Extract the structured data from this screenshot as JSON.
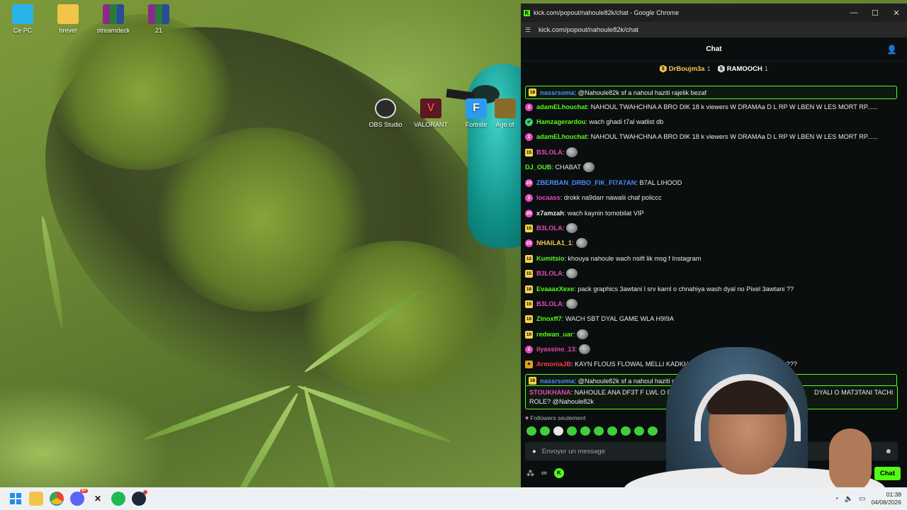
{
  "desktop": {
    "icons": [
      {
        "label": "Ce PC",
        "icon": "monitor-icon",
        "color": "#2ab3e8"
      },
      {
        "label": "brevet",
        "icon": "folder-icon",
        "color": "#f3c44a"
      },
      {
        "label": "streamdeck",
        "icon": "winrar-icon",
        "color": "#8a2a8a"
      },
      {
        "label": "21",
        "icon": "winrar-icon",
        "color": "#8a2a8a"
      },
      {
        "label": "OBS Studio",
        "icon": "obs-icon",
        "color": "#2b2b2b"
      },
      {
        "label": "VALORANT",
        "icon": "valorant-icon",
        "color": "#fa4454"
      },
      {
        "label": "Fortnite",
        "icon": "fortnite-icon",
        "color": "#2d9bf0"
      },
      {
        "label": "Age of",
        "icon": "age-of-empires-icon",
        "color": "#8a6a2a"
      }
    ]
  },
  "window": {
    "title": "kick.com/popout/nahoule82k/chat - Google Chrome",
    "url": "kick.com/popout/nahoule82k/chat",
    "controls": {
      "minimize": "—",
      "maximize": "☐",
      "close": "✕"
    }
  },
  "chat": {
    "header_title": "Chat",
    "leaderboard": [
      {
        "name": "DrBoujm3a",
        "count": "1",
        "color": "#f6c94a"
      },
      {
        "name": "RAMOOCH",
        "count": "1",
        "color": "#ffffff"
      }
    ],
    "messages": [
      {
        "badge": "18",
        "badge_type": "sub",
        "user": "nassrsoma",
        "color": "#4b8bff",
        "text": ": @Nahoule82k sf a nahoul haziti rajelik bezaf",
        "highlight": true
      },
      {
        "badge": "2",
        "badge_type": "round",
        "user": "adamELhouchat",
        "color": "#53fc18",
        "text": ": NAHOUL TWAHCHNA A BRO DIK 18 k viewers W DRAMAa D L RP W LBEN W LES MORT RP......",
        "highlight": false
      },
      {
        "badge": "✔",
        "badge_type": "green",
        "user": "Hamzagerardou",
        "color": "#53fc18",
        "text": ": wach ghadi t7al watlist db",
        "highlight": false
      },
      {
        "badge": "2",
        "badge_type": "round",
        "user": "adamELhouchat",
        "color": "#53fc18",
        "text": ": NAHOUL TWAHCHNA A BRO DIK 18 k viewers W DRAMAa D L RP W LBEN W LES MORT RP......",
        "highlight": false
      },
      {
        "badge": "15",
        "badge_type": "sub",
        "user": "B3LOLA",
        "color": "#e24bb5",
        "text": ":",
        "emote": true,
        "highlight": false
      },
      {
        "badge": "",
        "badge_type": "none",
        "user": "DJ_OUB",
        "color": "#53fc18",
        "text": ": CHABAT",
        "emote": true,
        "highlight": false
      },
      {
        "badge": "23",
        "badge_type": "round",
        "user": "ZBERBAN_DRBO_FIK_FI7A7AN",
        "color": "#4b8bff",
        "text": ": B7AL LIHOOD",
        "highlight": false
      },
      {
        "badge": "2",
        "badge_type": "round",
        "user": "locaass",
        "color": "#e24bb5",
        "text": ": drokk na9darr nawalii chaf policcc",
        "highlight": false
      },
      {
        "badge": "20",
        "badge_type": "round",
        "user": "x7amzah",
        "color": "#e9ecec",
        "text": ": wach kaynin tomobilat VIP",
        "highlight": false
      },
      {
        "badge": "15",
        "badge_type": "sub",
        "user": "B3LOLA",
        "color": "#e24bb5",
        "text": ":",
        "emote": true,
        "highlight": false
      },
      {
        "badge": "23",
        "badge_type": "round",
        "user": "NHAILA1_1",
        "color": "#f6c94a",
        "text": ":",
        "emote": true,
        "highlight": false
      },
      {
        "badge": "12",
        "badge_type": "sub",
        "user": "Kumitsio",
        "color": "#53fc18",
        "text": ": khouya nahoule wach nsift lik msg f Instagram",
        "highlight": false
      },
      {
        "badge": "15",
        "badge_type": "sub",
        "user": "B3LOLA",
        "color": "#e24bb5",
        "text": ":",
        "emote": true,
        "highlight": false
      },
      {
        "badge": "18",
        "badge_type": "sub",
        "user": "EvaaaxXexe",
        "color": "#53fc18",
        "text": ": pack graphics 3awtani l srv kaml o chnahiya wash dyal no Pixel 3awtani ??",
        "highlight": false
      },
      {
        "badge": "15",
        "badge_type": "sub",
        "user": "B3LOLA",
        "color": "#e24bb5",
        "text": ":",
        "emote": true,
        "highlight": false
      },
      {
        "badge": "10",
        "badge_type": "sub",
        "user": "Zinoxff7",
        "color": "#53fc18",
        "text": ": WACH SBT DYAL GAME WLA H9I9A",
        "highlight": false
      },
      {
        "badge": "10",
        "badge_type": "sub",
        "user": "redwan_uar",
        "color": "#53fc18",
        "text": ":",
        "emote": true,
        "highlight": false
      },
      {
        "badge": "2",
        "badge_type": "round",
        "user": "ilyassino_13",
        "color": "#e24bb5",
        "text": ":",
        "emote": true,
        "highlight": false
      },
      {
        "badge": "✦",
        "badge_type": "crown",
        "user": "ArmoniaJB",
        "color": "#ff3b3b",
        "text": ": KAYN FLOUS FLOWAL MELLI KADKHOL O",
        "trail": "RDER ???",
        "highlight": false
      },
      {
        "badge": "18",
        "badge_type": "sub",
        "user": "nassrsoma",
        "color": "#4b8bff",
        "text": ": @Nahoule82k sf a nahoul haziti rajelik b",
        "highlight": true
      }
    ],
    "last_message": {
      "user": "STOUKHANA",
      "color": "#e24bb5",
      "text_line1": ": NAHOULE ANA DF3T F LWL O DRT AL",
      "text_line1_right": "DYALI O MAT3TANI TACHI",
      "text_line2": "ROLE? @Nahoule82k"
    },
    "followers_only": "Followers seulement",
    "input_placeholder": "Envoyer un message",
    "send_button": "Chat"
  },
  "taskbar": {
    "time": "01:38",
    "date": "04/08/2026",
    "discord_badge": "9+"
  }
}
